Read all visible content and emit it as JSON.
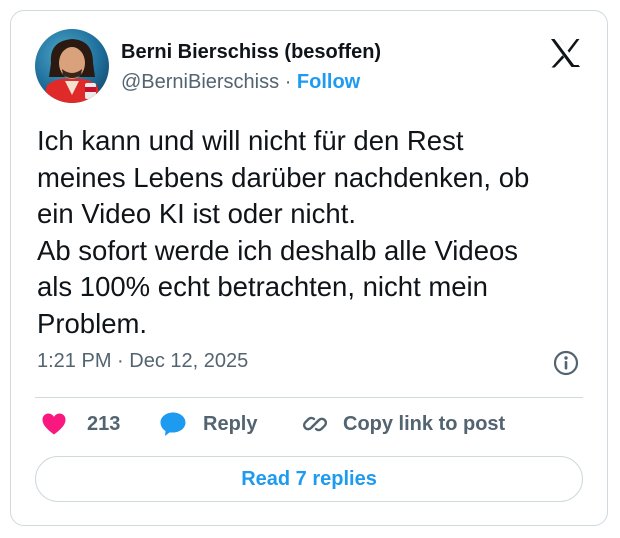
{
  "author": {
    "display_name": "Berni Bierschiss (besoffen)",
    "handle": "@BerniBierschiss",
    "separator": "·",
    "follow_label": "Follow"
  },
  "tweet": {
    "text_lines": [
      "Ich kann und will nicht für den Rest",
      "meines Lebens darüber nachdenken, ob",
      "ein Video KI ist oder nicht.",
      "Ab sofort werde ich deshalb alle Videos",
      "als 100% echt betrachten, nicht mein",
      "Problem."
    ],
    "timestamp": "1:21 PM · Dec 12, 2025"
  },
  "actions": {
    "like_count": "213",
    "reply_label": "Reply",
    "copy_link_label": "Copy link to post"
  },
  "footer": {
    "read_replies_label": "Read 7 replies"
  },
  "icons": {
    "logo": "x-logo-icon",
    "info": "info-icon",
    "like": "heart-icon",
    "reply": "speech-bubble-icon",
    "copy": "link-icon"
  },
  "colors": {
    "accent": "#1d9bf0",
    "like": "#f91880",
    "text_primary": "#0f1419",
    "text_secondary": "#536471",
    "border": "#cfd9de"
  }
}
